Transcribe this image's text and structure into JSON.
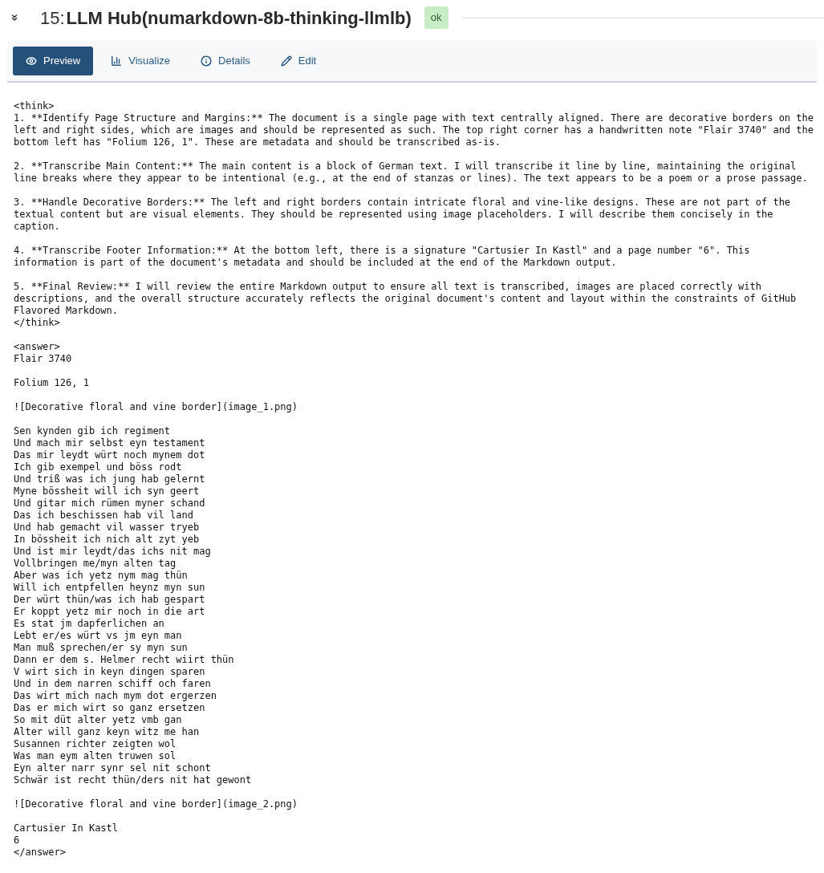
{
  "header": {
    "number": "15:",
    "title": "LLM Hub(numarkdown-8b-thinking-llmlb)",
    "status": "ok"
  },
  "tabs": [
    {
      "label": "Preview",
      "selected": true
    },
    {
      "label": "Visualize",
      "selected": false
    },
    {
      "label": "Details",
      "selected": false
    },
    {
      "label": "Edit",
      "selected": false
    }
  ],
  "output": [
    [
      "<think>",
      "1. **Identify Page Structure and Margins:** The document is a single page with text centrally aligned. There are decorative borders on the",
      "left and right sides, which are images and should be represented as such. The top right corner has a handwritten note \"Flair 3740\" and the",
      "bottom left has \"Folium 126, 1\". These are metadata and should be transcribed as-is."
    ],
    [
      "2. **Transcribe Main Content:** The main content is a block of German text. I will transcribe it line by line, maintaining the original",
      "line breaks where they appear to be intentional (e.g., at the end of stanzas or lines). The text appears to be a poem or a prose passage."
    ],
    [
      "3. **Handle Decorative Borders:** The left and right borders contain intricate floral and vine-like designs. These are not part of the",
      "textual content but are visual elements. They should be represented using image placeholders. I will describe them concisely in the",
      "caption."
    ],
    [
      "4. **Transcribe Footer Information:** At the bottom left, there is a signature \"Cartusier In Kastl\" and a page number \"6\". This",
      "information is part of the document's metadata and should be included at the end of the Markdown output."
    ],
    [
      "5. **Final Review:** I will review the entire Markdown output to ensure all text is transcribed, images are placed correctly with",
      "descriptions, and the overall structure accurately reflects the original document's content and layout within the constraints of GitHub",
      "Flavored Markdown.",
      "</think>"
    ],
    [
      "<answer>",
      "Flair 3740"
    ],
    [
      "Folium 126, 1"
    ],
    [
      "![Decorative floral and vine border](image_1.png)"
    ],
    [
      "Sen kynden gib ich regiment",
      "Und mach mir selbst eyn testament",
      "Das mir leydt würt noch mynem dot",
      "Ich gib exempel und böss rodt",
      "Und triß was ich jung hab gelernt",
      "Myne bössheit will ich syn geert",
      "Und gitar mich rümen myner schand",
      "Das ich beschissen hab vil land",
      "Und hab gemacht vil wasser tryeb",
      "In bössheit ich nich alt zyt yeb",
      "Und ist mir leydt/das ichs nit mag",
      "Vollbringen me/myn alten tag",
      "Aber was ich yetz nym mag thün",
      "Will ich entpfellen heynz myn sun",
      "Der würt thün/was ich hab gespart",
      "Er koppt yetz mir noch in die art",
      "Es stat jm dapferlichen an",
      "Lebt er/es würt vs jm eyn man",
      "Man muß sprechen/er sy myn sun",
      "Dann er dem s. Helmer recht wiirt thün",
      "V wirt sich in keyn dingen sparen",
      "Und in dem narren schiff och faren",
      "Das wirt mich nach mym dot ergerzen",
      "Das er mich wirt so ganz ersetzen",
      "So mit düt alter yetz vmb gan",
      "Alter will ganz keyn witz me han",
      "Susannen richter zeigten wol",
      "Was man eym alten truwen sol",
      "Eyn alter narr synr sel nit schont",
      "Schwär ist recht thün/ders nit hat gewont"
    ],
    [
      "![Decorative floral and vine border](image_2.png)"
    ],
    [
      "Cartusier In Kastl",
      "6",
      "</answer>"
    ]
  ]
}
